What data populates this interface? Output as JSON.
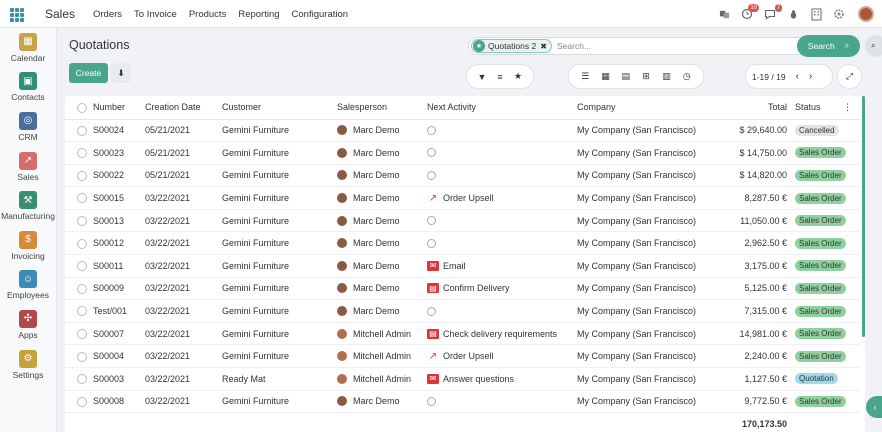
{
  "app": {
    "name": "Sales"
  },
  "topnav": {
    "items": [
      "Orders",
      "To Invoice",
      "Products",
      "Reporting",
      "Configuration"
    ],
    "badges": {
      "activities": "10",
      "messages": "7"
    }
  },
  "sidebar": {
    "items": [
      {
        "label": "Calendar",
        "icon": "calendar-icon",
        "color": "#c9a34a"
      },
      {
        "label": "Contacts",
        "icon": "contacts-icon",
        "color": "#2f8f7a"
      },
      {
        "label": "CRM",
        "icon": "crm-icon",
        "color": "#4a6f9d"
      },
      {
        "label": "Sales",
        "icon": "sales-icon",
        "color": "#d16e6e"
      },
      {
        "label": "Manufacturing",
        "icon": "manufacturing-icon",
        "color": "#3c8f6e"
      },
      {
        "label": "Invoicing",
        "icon": "invoicing-icon",
        "color": "#d78a3c"
      },
      {
        "label": "Employees",
        "icon": "employees-icon",
        "color": "#3b8bb8"
      },
      {
        "label": "Apps",
        "icon": "apps-icon",
        "color": "#b04a4a"
      },
      {
        "label": "Settings",
        "icon": "settings-icon",
        "color": "#c7a23a"
      }
    ]
  },
  "page": {
    "title": "Quotations",
    "create_label": "Create"
  },
  "search": {
    "facet": "Quotations 2",
    "placeholder": "Search...",
    "button_label": "Search"
  },
  "pager": {
    "value": "1-19 / 19"
  },
  "table": {
    "headers": {
      "number": "Number",
      "creation_date": "Creation Date",
      "customer": "Customer",
      "salesperson": "Salesperson",
      "next_activity": "Next Activity",
      "company": "Company",
      "total": "Total",
      "status": "Status"
    },
    "rows": [
      {
        "number": "S00024",
        "date": "05/21/2021",
        "customer": "Gemini Furniture",
        "salesperson": "Marc Demo",
        "activity": "",
        "activity_icon": "clock-icon",
        "company": "My Company (San Francisco)",
        "total": "$ 29,640.00",
        "status": "Cancelled"
      },
      {
        "number": "S00023",
        "date": "05/21/2021",
        "customer": "Gemini Furniture",
        "salesperson": "Marc Demo",
        "activity": "",
        "activity_icon": "clock-icon",
        "company": "My Company (San Francisco)",
        "total": "$ 14,750.00",
        "status": "Sales Order"
      },
      {
        "number": "S00022",
        "date": "05/21/2021",
        "customer": "Gemini Furniture",
        "salesperson": "Marc Demo",
        "activity": "",
        "activity_icon": "clock-icon",
        "company": "My Company (San Francisco)",
        "total": "$ 14,820.00",
        "status": "Sales Order"
      },
      {
        "number": "S00015",
        "date": "03/22/2021",
        "customer": "Gemini Furniture",
        "salesperson": "Marc Demo",
        "activity": "Order Upsell",
        "activity_icon": "upsell-icon",
        "company": "My Company (San Francisco)",
        "total": "8,287.50 €",
        "status": "Sales Order"
      },
      {
        "number": "S00013",
        "date": "03/22/2021",
        "customer": "Gemini Furniture",
        "salesperson": "Marc Demo",
        "activity": "",
        "activity_icon": "clock-icon",
        "company": "My Company (San Francisco)",
        "total": "11,050.00 €",
        "status": "Sales Order"
      },
      {
        "number": "S00012",
        "date": "03/22/2021",
        "customer": "Gemini Furniture",
        "salesperson": "Marc Demo",
        "activity": "",
        "activity_icon": "clock-icon",
        "company": "My Company (San Francisco)",
        "total": "2,962.50 €",
        "status": "Sales Order"
      },
      {
        "number": "S00011",
        "date": "03/22/2021",
        "customer": "Gemini Furniture",
        "salesperson": "Marc Demo",
        "activity": "Email",
        "activity_icon": "email-icon",
        "company": "My Company (San Francisco)",
        "total": "3,175.00 €",
        "status": "Sales Order"
      },
      {
        "number": "S00009",
        "date": "03/22/2021",
        "customer": "Gemini Furniture",
        "salesperson": "Marc Demo",
        "activity": "Confirm Delivery",
        "activity_icon": "delivery-icon",
        "company": "My Company (San Francisco)",
        "total": "5,125.00 €",
        "status": "Sales Order"
      },
      {
        "number": "Test/001",
        "date": "03/22/2021",
        "customer": "Gemini Furniture",
        "salesperson": "Marc Demo",
        "activity": "",
        "activity_icon": "clock-icon",
        "company": "My Company (San Francisco)",
        "total": "7,315.00 €",
        "status": "Sales Order"
      },
      {
        "number": "S00007",
        "date": "03/22/2021",
        "customer": "Gemini Furniture",
        "salesperson": "Mitchell Admin",
        "activity": "Check delivery requirements",
        "activity_icon": "delivery-icon",
        "company": "My Company (San Francisco)",
        "total": "14,981.00 €",
        "status": "Sales Order"
      },
      {
        "number": "S00004",
        "date": "03/22/2021",
        "customer": "Gemini Furniture",
        "salesperson": "Mitchell Admin",
        "activity": "Order Upsell",
        "activity_icon": "upsell-icon",
        "company": "My Company (San Francisco)",
        "total": "2,240.00 €",
        "status": "Sales Order"
      },
      {
        "number": "S00003",
        "date": "03/22/2021",
        "customer": "Ready Mat",
        "salesperson": "Mitchell Admin",
        "activity": "Answer questions",
        "activity_icon": "email-icon",
        "company": "My Company (San Francisco)",
        "total": "1,127.50 €",
        "status": "Quotation"
      },
      {
        "number": "S00008",
        "date": "03/22/2021",
        "customer": "Gemini Furniture",
        "salesperson": "Marc Demo",
        "activity": "",
        "activity_icon": "clock-icon",
        "company": "My Company (San Francisco)",
        "total": "9,772.50 €",
        "status": "Sales Order"
      }
    ],
    "grand_total": "170,173.50"
  },
  "colors": {
    "accent": "#49a58c",
    "status_sales_order": "#8fd19e",
    "status_cancelled": "#e2e3e5",
    "status_quotation": "#9fd9ec",
    "activity_red": "#d9373a"
  }
}
